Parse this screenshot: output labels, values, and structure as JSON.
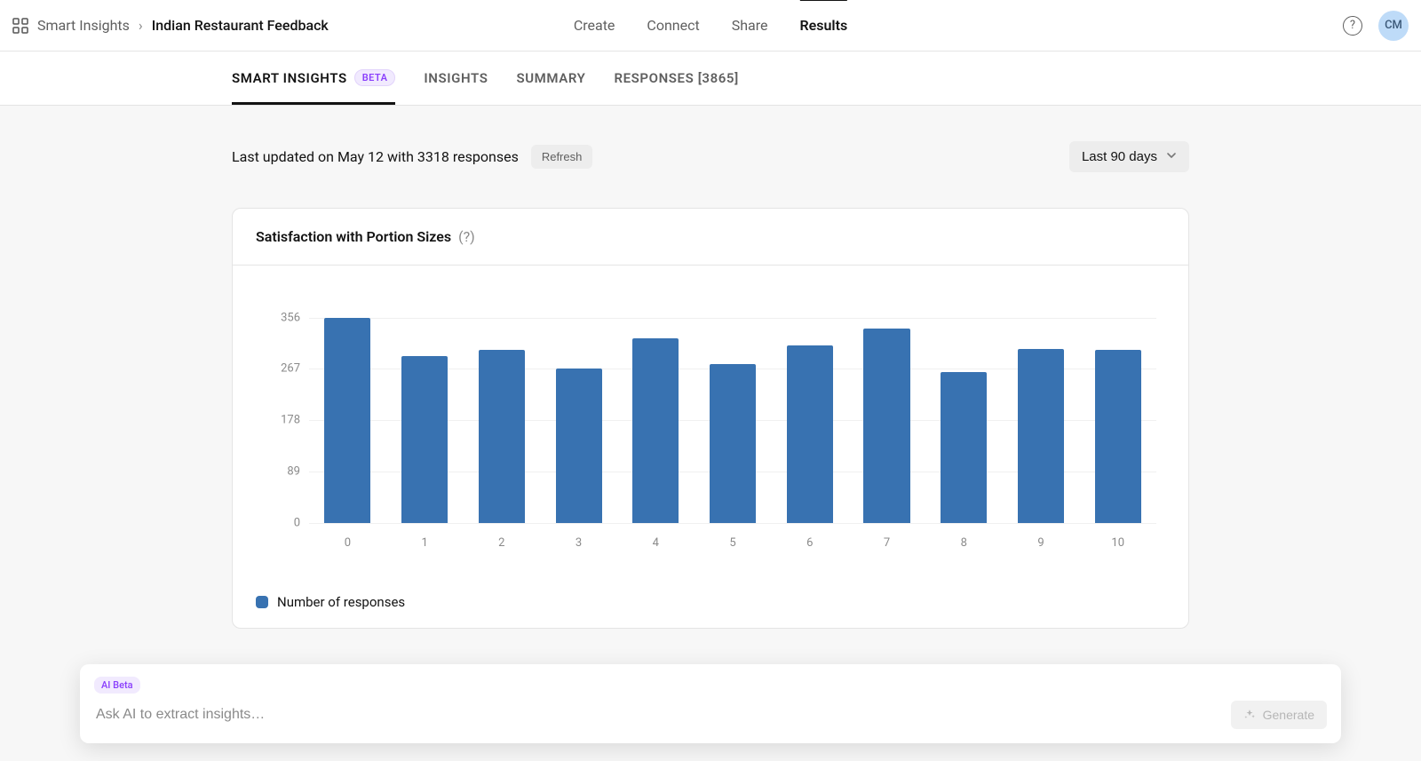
{
  "top": {
    "breadcrumb_root": "Smart Insights",
    "breadcrumb_current": "Indian Restaurant Feedback",
    "nav": [
      "Create",
      "Connect",
      "Share",
      "Results"
    ],
    "nav_active_index": 3,
    "avatar_initials": "CM"
  },
  "subtabs": {
    "items": [
      {
        "label": "SMART INSIGHTS",
        "badge": "BETA"
      },
      {
        "label": "INSIGHTS"
      },
      {
        "label": "SUMMARY"
      },
      {
        "label": "RESPONSES [3865]"
      }
    ],
    "active_index": 0
  },
  "status": {
    "text": "Last updated on May 12 with 3318 responses",
    "refresh_label": "Refresh",
    "range_label": "Last 90 days"
  },
  "card": {
    "title": "Satisfaction with Portion Sizes",
    "help": "(?)",
    "legend_label": "Number of responses"
  },
  "ai": {
    "badge": "AI Beta",
    "placeholder": "Ask AI to extract insights…",
    "generate_label": "Generate"
  },
  "chart_data": {
    "type": "bar",
    "title": "Satisfaction with Portion Sizes",
    "xlabel": "",
    "ylabel": "",
    "categories": [
      "0",
      "1",
      "2",
      "3",
      "4",
      "5",
      "6",
      "7",
      "8",
      "9",
      "10"
    ],
    "values": [
      356,
      290,
      300,
      267,
      320,
      276,
      308,
      337,
      262,
      302,
      300
    ],
    "y_ticks": [
      0,
      89,
      178,
      267,
      356
    ],
    "ylim": [
      0,
      400
    ],
    "series_name": "Number of responses",
    "bar_color": "#3872b1"
  }
}
